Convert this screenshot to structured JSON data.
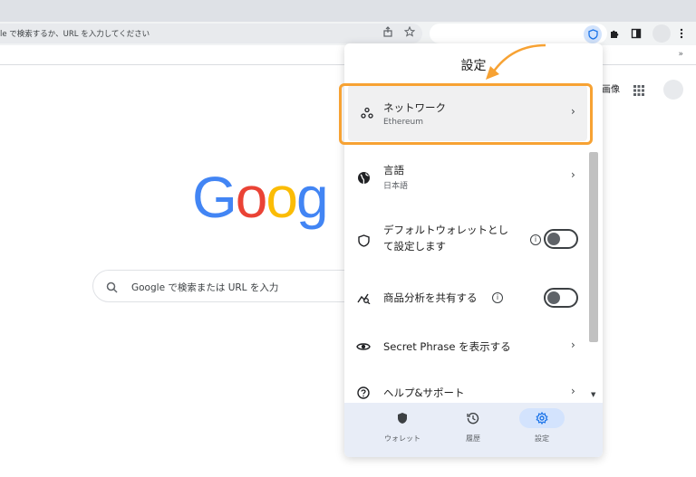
{
  "browser": {
    "omnibox_text": "le で検索するか、URL を入力してください",
    "bookmarks_more": "»"
  },
  "google": {
    "images_link": "画像",
    "logo_letters": [
      {
        "ch": "G",
        "color": "#4285f4"
      },
      {
        "ch": "o",
        "color": "#ea4335"
      },
      {
        "ch": "o",
        "color": "#fbbc05"
      },
      {
        "ch": "g",
        "color": "#4285f4"
      }
    ],
    "search_placeholder": "Google で検索または URL を入力"
  },
  "popup": {
    "title": "設定",
    "items": [
      {
        "label": "ネットワーク",
        "sub": "Ethereum",
        "icon": "network-icon"
      },
      {
        "label": "言語",
        "sub": "日本語",
        "icon": "globe-icon"
      },
      {
        "label_line1": "デフォルトウォレットとし",
        "label_line2": "て設定します",
        "icon": "shield-icon",
        "toggle": "off"
      },
      {
        "label": "商品分析を共有する",
        "icon": "analytics-icon",
        "toggle": "off"
      },
      {
        "label": "Secret Phrase を表示する",
        "icon": "eye-icon"
      },
      {
        "label": "ヘルプ&サポート",
        "icon": "help-icon"
      }
    ],
    "chevron": "›",
    "info_glyph": "i",
    "nav": [
      {
        "label": "ウォレット",
        "icon": "wallet-icon"
      },
      {
        "label": "履歴",
        "icon": "history-icon"
      },
      {
        "label": "設定",
        "icon": "settings-icon",
        "active": true
      }
    ]
  },
  "colors": {
    "highlight": "#f7a233",
    "nav_active": "#d3e3fd",
    "settings_blue": "#1a73e8"
  }
}
